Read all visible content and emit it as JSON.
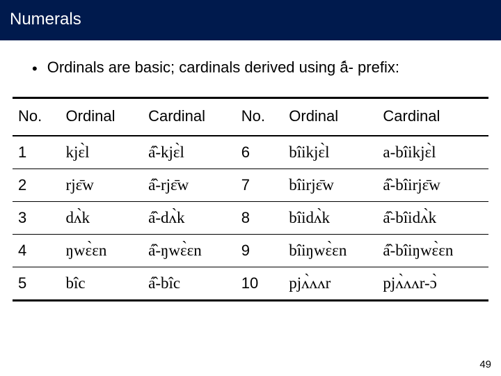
{
  "title": "Numerals",
  "bullet": "Ordinals are basic; cardinals derived using á̂- prefix:",
  "headers": {
    "no": "No.",
    "ordinal": "Ordinal",
    "cardinal": "Cardinal"
  },
  "rows_left": [
    {
      "no": "1",
      "ordinal": "kjɛ̀l",
      "cardinal": "á̂-kjɛ̀l"
    },
    {
      "no": "2",
      "ordinal": "rjɛ̄w",
      "cardinal": "á̂-rjɛ̄w"
    },
    {
      "no": "3",
      "ordinal": "dʌ̀k",
      "cardinal": "á̂-dʌ̀k"
    },
    {
      "no": "4",
      "ordinal": "ŋwɛ̀ɛn",
      "cardinal": "á̂-ŋwɛ̀ɛn"
    },
    {
      "no": "5",
      "ordinal": "bîc",
      "cardinal": "á̂-bîc"
    }
  ],
  "rows_right": [
    {
      "no": "6",
      "ordinal": "bîikjɛ̀l",
      "cardinal": "a-bîikjɛ̀l"
    },
    {
      "no": "7",
      "ordinal": "bîirjɛ̄w",
      "cardinal": "á̂-bîirjɛ̄w"
    },
    {
      "no": "8",
      "ordinal": "bîidʌ̀k",
      "cardinal": "á̂-bîidʌ̀k"
    },
    {
      "no": "9",
      "ordinal": "bîiŋwɛ̀ɛn",
      "cardinal": "á̂-bîiŋwɛ̀ɛn"
    },
    {
      "no": "10",
      "ordinal": "pjʌ̀ʌʌr",
      "cardinal": "pjʌ̀ʌʌr-ɔ̀"
    }
  ],
  "page_number": "49"
}
